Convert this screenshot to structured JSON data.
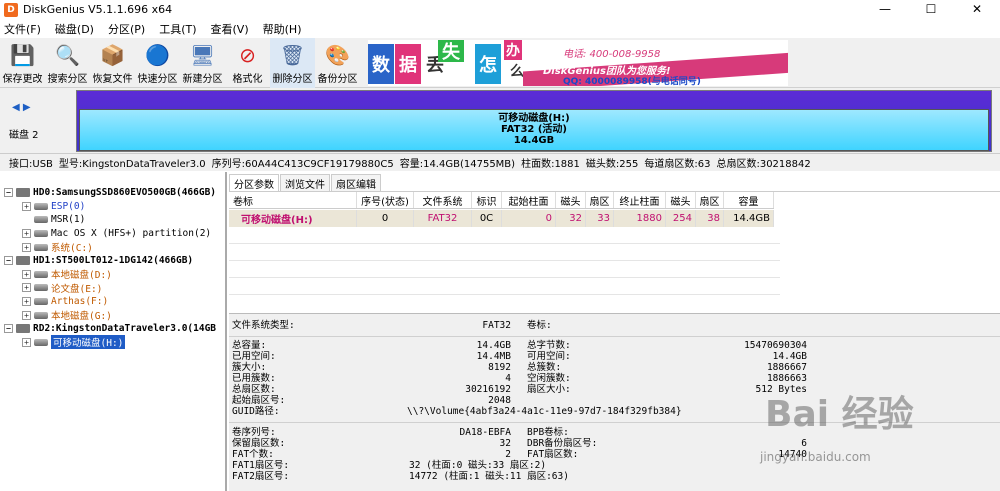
{
  "app": {
    "title": "DiskGenius V5.1.1.696 x64",
    "icon_letter": "D"
  },
  "window_controls": {
    "min": "—",
    "max": "☐",
    "close": "✕"
  },
  "menu": [
    "文件(F)",
    "磁盘(D)",
    "分区(P)",
    "工具(T)",
    "查看(V)",
    "帮助(H)"
  ],
  "toolbar": [
    {
      "label": "保存更改",
      "icon": "save-icon",
      "glyph": "💾"
    },
    {
      "label": "搜索分区",
      "icon": "search-icon",
      "glyph": "🔍"
    },
    {
      "label": "恢复文件",
      "icon": "recover-icon",
      "glyph": "📦"
    },
    {
      "label": "快速分区",
      "icon": "quick-partition-icon",
      "glyph": "🔵"
    },
    {
      "label": "新建分区",
      "icon": "new-partition-icon",
      "glyph": "🖥"
    },
    {
      "label": "格式化",
      "icon": "format-icon",
      "glyph": "⊘"
    },
    {
      "label": "删除分区",
      "icon": "delete-partition-icon",
      "glyph": "🗑"
    },
    {
      "label": "备份分区",
      "icon": "backup-icon",
      "glyph": "🎨"
    }
  ],
  "ad": {
    "tiles": [
      "数",
      "据",
      "丢",
      "失",
      "怎",
      "么",
      "办",
      "!"
    ],
    "slogan": "DiskGenius团队为您服务!",
    "tel": "电话: 400-008-9958",
    "qq": "QQ: 4000089958(与电话同号)"
  },
  "diskbar": {
    "disk_label": "磁盘 2",
    "part_name": "可移动磁盘(H:)",
    "part_fs": "FAT32 (活动)",
    "part_size": "14.4GB"
  },
  "infobar": {
    "iface": "接口:USB",
    "model": "型号:KingstonDataTraveler3.0",
    "serial": "序列号:60A44C413C9CF19179880C5",
    "capacity": "容量:14.4GB(14755MB)",
    "cylinders": "柱面数:1881",
    "heads": "磁头数:255",
    "sectors_per_track": "每道扇区数:63",
    "total_sectors": "总扇区数:30218842"
  },
  "tree": [
    {
      "level": 0,
      "text": "HD0:SamsungSSD860EVO500GB(466GB)",
      "bold": true,
      "toggle": "−",
      "type": "disk"
    },
    {
      "level": 1,
      "text": "ESP(0)",
      "color": "blue",
      "toggle": "+",
      "type": "part"
    },
    {
      "level": 1,
      "text": "MSR(1)",
      "color": "",
      "toggle": "",
      "type": "part"
    },
    {
      "level": 1,
      "text": "Mac OS X (HFS+) partition(2)",
      "color": "",
      "toggle": "+",
      "type": "part"
    },
    {
      "level": 1,
      "text": "系统(C:)",
      "color": "orange",
      "toggle": "+",
      "type": "part"
    },
    {
      "level": 0,
      "text": "HD1:ST500LT012-1DG142(466GB)",
      "bold": true,
      "toggle": "−",
      "type": "disk"
    },
    {
      "level": 1,
      "text": "本地磁盘(D:)",
      "color": "orange",
      "toggle": "+",
      "type": "part"
    },
    {
      "level": 1,
      "text": "论文盘(E:)",
      "color": "orange",
      "toggle": "+",
      "type": "part"
    },
    {
      "level": 1,
      "text": "Arthas(F:)",
      "color": "orange",
      "toggle": "+",
      "type": "part"
    },
    {
      "level": 1,
      "text": "本地磁盘(G:)",
      "color": "orange",
      "toggle": "+",
      "type": "part"
    },
    {
      "level": 0,
      "text": "RD2:KingstonDataTraveler3.0(14GB",
      "bold": true,
      "toggle": "−",
      "type": "disk"
    },
    {
      "level": 1,
      "text": "可移动磁盘(H:)",
      "color": "",
      "toggle": "+",
      "type": "part",
      "selected": true
    }
  ],
  "tabs": [
    "分区参数",
    "浏览文件",
    "扇区编辑"
  ],
  "table": {
    "columns": [
      "卷标",
      "序号(状态)",
      "文件系统",
      "标识",
      "起始柱面",
      "磁头",
      "扇区",
      "终止柱面",
      "磁头",
      "扇区",
      "容量"
    ],
    "rows": [
      [
        "可移动磁盘(H:)",
        "0",
        "FAT32",
        "0C",
        "0",
        "32",
        "33",
        "1880",
        "254",
        "38",
        "14.4GB"
      ]
    ]
  },
  "details": {
    "fs_type_label": "文件系统类型:",
    "fs_type": "FAT32",
    "volume_label_label": "卷标:",
    "left1": [
      [
        "总容量:",
        "14.4GB"
      ],
      [
        "已用空间:",
        "14.4MB"
      ],
      [
        "簇大小:",
        "8192"
      ],
      [
        "已用簇数:",
        "4"
      ],
      [
        "总扇区数:",
        "30216192"
      ],
      [
        "起始扇区号:",
        "2048"
      ]
    ],
    "right1": [
      [
        "总字节数:",
        "15470690304"
      ],
      [
        "可用空间:",
        "14.4GB"
      ],
      [
        "总簇数:",
        "1886667"
      ],
      [
        "空闲簇数:",
        "1886663"
      ],
      [
        "扇区大小:",
        "512 Bytes"
      ]
    ],
    "guid_label": "GUID路径:",
    "guid": "\\\\?\\Volume{4abf3a24-4a1c-11e9-97d7-184f329fb384}",
    "left2": [
      [
        "卷序列号:",
        "DA18-EBFA"
      ],
      [
        "保留扇区数:",
        "32"
      ],
      [
        "FAT个数:",
        "2"
      ],
      [
        "FAT1扇区号:",
        "32 (柱面:0 磁头:33 扇区:2)"
      ],
      [
        "FAT2扇区号:",
        "14772 (柱面:1 磁头:11 扇区:63)"
      ]
    ],
    "right2": [
      [
        "BPB卷标:",
        ""
      ],
      [
        "DBR备份扇区号:",
        "6"
      ],
      [
        "FAT扇区数:",
        "14740"
      ]
    ]
  },
  "watermark": {
    "brand": "Bai 经验",
    "url": "jingyan.baidu.com"
  }
}
